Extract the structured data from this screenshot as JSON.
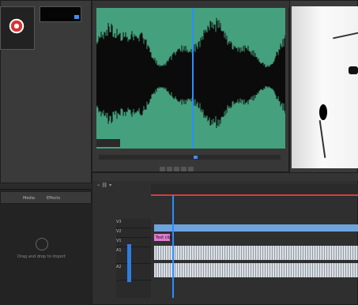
{
  "colors": {
    "waveform_bg": "#45a07e",
    "waveform": "#0b0b0b",
    "playhead": "#2d8cff",
    "video_track": "#6ea4de",
    "pink_clip": "#e07ad4",
    "workarea_red": "#d04040"
  },
  "project": {
    "tab_labels": [
      "Media",
      "Effects"
    ],
    "bin_icon": "film-reel-icon",
    "empty_text": "Drag and drop to import"
  },
  "tracks": {
    "video": [
      "V3",
      "V2",
      "V1"
    ],
    "audio": [
      "A1",
      "A2"
    ]
  },
  "clips": {
    "pink_label": "Text clip"
  }
}
